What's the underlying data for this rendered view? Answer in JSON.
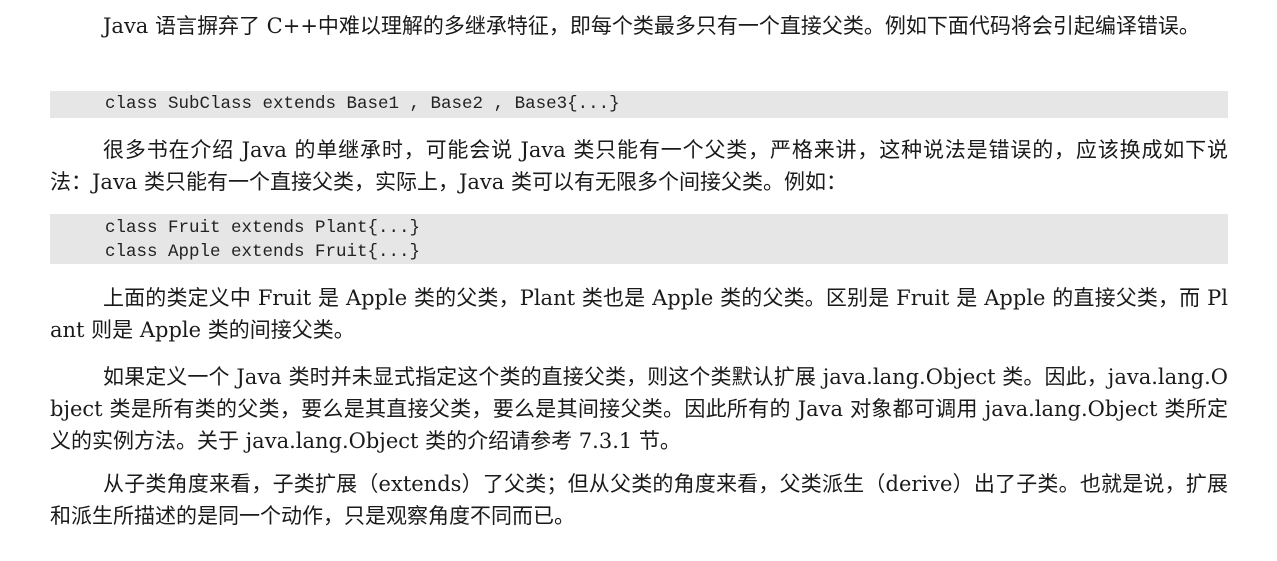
{
  "paragraphs": [
    "Java 语言摒弃了 C++中难以理解的多继承特征，即每个类最多只有一个直接父类。例如下面代码将会引起编译错误。",
    "很多书在介绍 Java 的单继承时，可能会说 Java 类只能有一个父类，严格来讲，这种说法是错误的，应该换成如下说法：Java 类只能有一个直接父类，实际上，Java 类可以有无限多个间接父类。例如：",
    "上面的类定义中 Fruit 是 Apple 类的父类，Plant 类也是 Apple 类的父类。区别是 Fruit 是 Apple 的直接父类，而 Plant 则是 Apple 类的间接父类。",
    "如果定义一个 Java 类时并未显式指定这个类的直接父类，则这个类默认扩展 java.lang.Object 类。因此，java.lang.Object 类是所有类的父类，要么是其直接父类，要么是其间接父类。因此所有的 Java 对象都可调用 java.lang.Object 类所定义的实例方法。关于 java.lang.Object 类的介绍请参考 7.3.1 节。",
    "从子类角度来看，子类扩展（extends）了父类；但从父类的角度来看，父类派生（derive）出了子类。也就是说，扩展和派生所描述的是同一个动作，只是观察角度不同而已。"
  ],
  "code_blocks": [
    [
      "class SubClass extends Base1 , Base2 , Base3{...}"
    ],
    [
      "class Fruit extends Plant{...}",
      "class Apple extends Fruit{...}"
    ]
  ]
}
